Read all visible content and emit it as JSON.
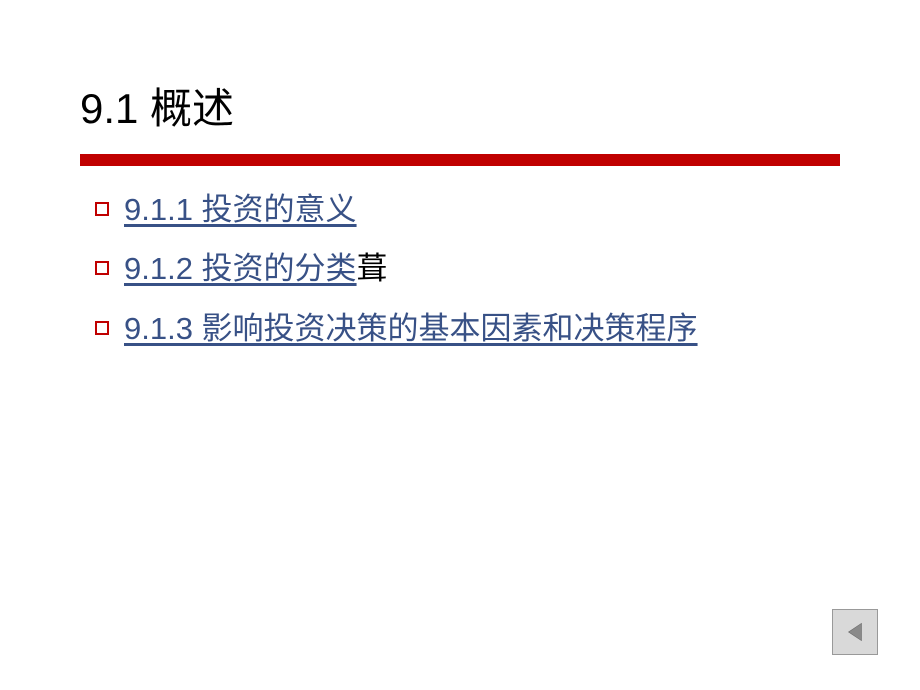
{
  "title": "9.1 概述",
  "items": [
    {
      "link": "9.1.1 投资的意义",
      "suffix": ""
    },
    {
      "link": "9.1.2 投资的分类",
      "suffix": "葺"
    },
    {
      "link": "9.1.3 影响投资决策的基本因素和决策程序",
      "suffix": ""
    }
  ],
  "colors": {
    "accent": "#c00000",
    "link": "#385186"
  }
}
